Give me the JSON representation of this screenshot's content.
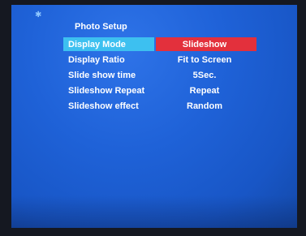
{
  "colors": {
    "background": "#1f62d8",
    "label_highlight": "#3dc0f0",
    "value_highlight": "#e3303c",
    "text": "#ffffff"
  },
  "header": {
    "icon": "star-icon",
    "title": "Photo Setup"
  },
  "menu": {
    "items": [
      {
        "label": "Display Mode",
        "value": "Slideshow",
        "selected": true
      },
      {
        "label": "Display Ratio",
        "value": "Fit to Screen",
        "selected": false
      },
      {
        "label": "Slide show time",
        "value": "5Sec.",
        "selected": false
      },
      {
        "label": "Slideshow Repeat",
        "value": "Repeat",
        "selected": false
      },
      {
        "label": "Slideshow effect",
        "value": "Random",
        "selected": false
      }
    ]
  }
}
